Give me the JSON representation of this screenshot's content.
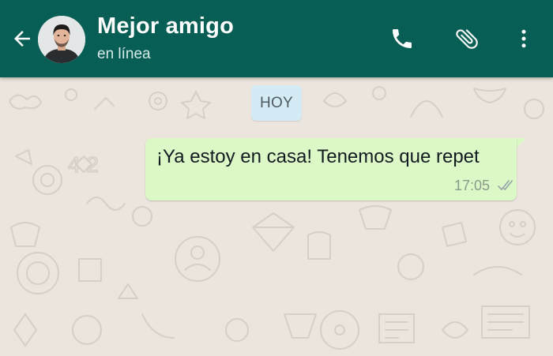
{
  "header": {
    "contact_name": "Mejor amigo",
    "status": "en línea",
    "icons": {
      "back": "arrow-back-icon",
      "call": "phone-icon",
      "attach": "paperclip-icon",
      "menu": "more-vert-icon"
    }
  },
  "chat": {
    "date_label": "HOY",
    "messages": [
      {
        "direction": "outgoing",
        "text": "¡Ya estoy en casa! Tenemos que repet",
        "time": "17:05",
        "status_icon": "double-check-icon"
      }
    ]
  },
  "colors": {
    "header": "#075e54",
    "outgoing_bubble": "#dcf8c6",
    "date_chip": "#d4eaf4",
    "wallpaper": "#ece5dd"
  }
}
